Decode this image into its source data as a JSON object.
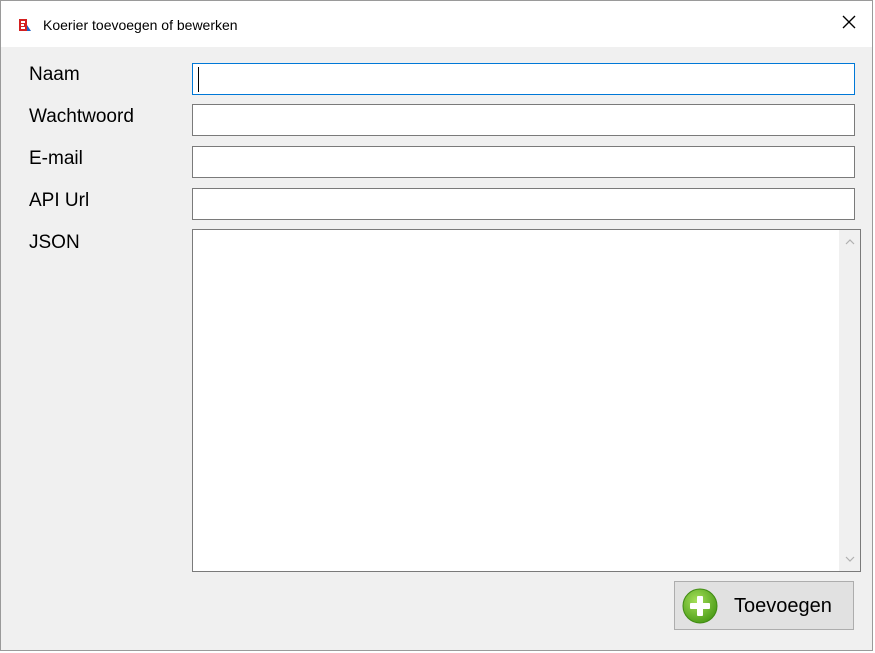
{
  "window": {
    "title": "Koerier toevoegen of bewerken",
    "icon": "app-logo-icon",
    "close_icon": "close-icon"
  },
  "form": {
    "name_label": "Naam",
    "password_label": "Wachtwoord",
    "email_label": "E-mail",
    "api_url_label": "API Url",
    "json_label": "JSON",
    "name_value": "",
    "password_value": "",
    "email_value": "",
    "api_url_value": "",
    "json_value": ""
  },
  "actions": {
    "add_label": "Toevoegen",
    "add_icon": "plus-circle-icon"
  },
  "colors": {
    "focus_border": "#0078d7",
    "add_icon_green": "#6cc22a"
  }
}
